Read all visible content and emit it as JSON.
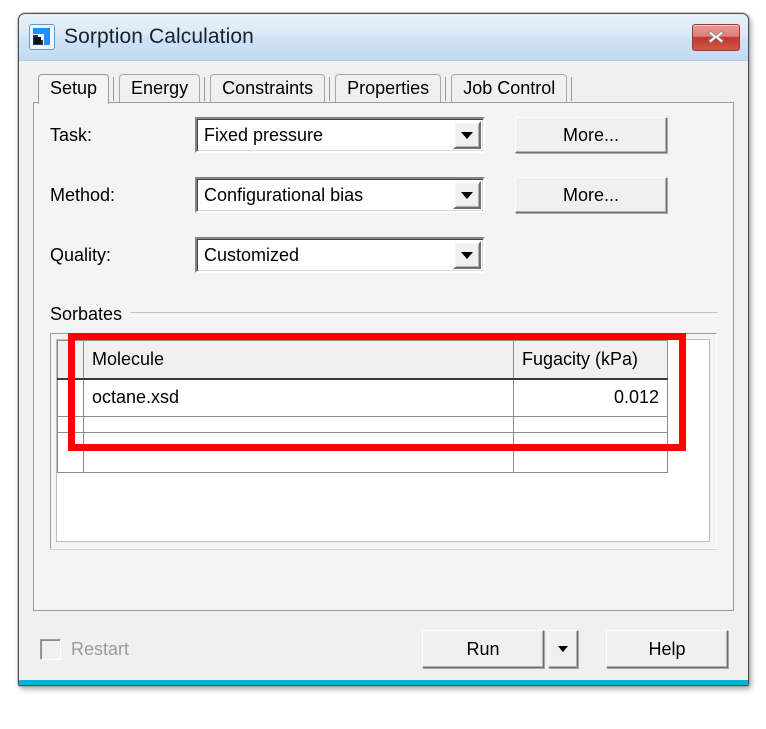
{
  "window": {
    "title": "Sorption Calculation",
    "icon": "sorption-app-icon",
    "close_label": "close-icon",
    "accent_color": "#00b4d8",
    "titlebar_color": "#cfe2f5",
    "close_color": "#c0362c"
  },
  "tabs": [
    {
      "label": "Setup",
      "active": true
    },
    {
      "label": "Energy",
      "active": false
    },
    {
      "label": "Constraints",
      "active": false
    },
    {
      "label": "Properties",
      "active": false
    },
    {
      "label": "Job Control",
      "active": false
    }
  ],
  "setup": {
    "rows": [
      {
        "label": "Task:",
        "value": "Fixed pressure",
        "has_more": true,
        "more_label": "More..."
      },
      {
        "label": "Method:",
        "value": "Configurational bias",
        "has_more": true,
        "more_label": "More..."
      },
      {
        "label": "Quality:",
        "value": "Customized",
        "has_more": false,
        "more_label": ""
      }
    ],
    "sorbates": {
      "group_title": "Sorbates",
      "columns": [
        "Molecule",
        "Fugacity (kPa)"
      ],
      "rows": [
        {
          "molecule": "octane.xsd",
          "fugacity": "0.012"
        }
      ],
      "empty_rows": 2,
      "highlight_color": "#ff0000"
    }
  },
  "footer": {
    "restart_label": "Restart",
    "restart_checked": false,
    "restart_enabled": false,
    "run_label": "Run",
    "run_split_icon": "chevron-down-icon",
    "help_label": "Help"
  }
}
